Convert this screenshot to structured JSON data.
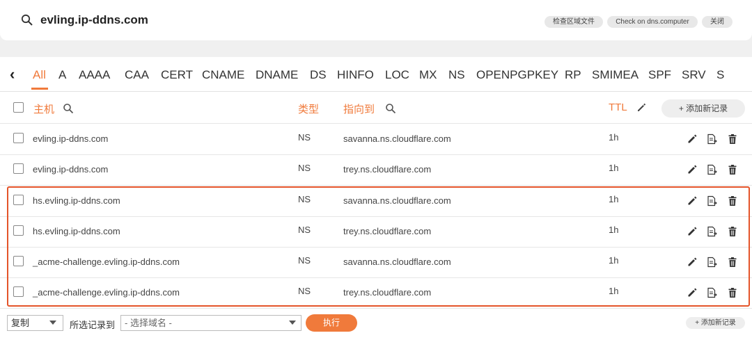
{
  "header": {
    "domain": "evling.ip-ddns.com",
    "buttons": [
      "检查区域文件",
      "Check on dns.computer",
      "关闭"
    ]
  },
  "tabs": [
    "All",
    "A",
    "AAAA",
    "CAA",
    "CERT",
    "CNAME",
    "DNAME",
    "DS",
    "HINFO",
    "LOC",
    "MX",
    "NS",
    "OPENPGPKEY",
    "RP",
    "SMIMEA",
    "SPF",
    "SRV",
    "S"
  ],
  "active_tab": "All",
  "columns": {
    "host": "主机",
    "type": "类型",
    "target": "指向到",
    "ttl": "TTL"
  },
  "add_record_label": "+ 添加新记录",
  "records": [
    {
      "host": "evling.ip-ddns.com",
      "type": "NS",
      "target": "savanna.ns.cloudflare.com",
      "ttl": "1h"
    },
    {
      "host": "evling.ip-ddns.com",
      "type": "NS",
      "target": "trey.ns.cloudflare.com",
      "ttl": "1h"
    },
    {
      "host": "hs.evling.ip-ddns.com",
      "type": "NS",
      "target": "savanna.ns.cloudflare.com",
      "ttl": "1h"
    },
    {
      "host": "hs.evling.ip-ddns.com",
      "type": "NS",
      "target": "trey.ns.cloudflare.com",
      "ttl": "1h"
    },
    {
      "host": "_acme-challenge.evling.ip-ddns.com",
      "type": "NS",
      "target": "savanna.ns.cloudflare.com",
      "ttl": "1h"
    },
    {
      "host": "_acme-challenge.evling.ip-ddns.com",
      "type": "NS",
      "target": "trey.ns.cloudflare.com",
      "ttl": "1h"
    }
  ],
  "footer": {
    "action_select": "复制",
    "label": "所选记录到",
    "domain_select": "- 选择域名 -",
    "execute": "执行",
    "add_record_label": "+ 添加新记录"
  },
  "colors": {
    "accent": "#f07a3b",
    "highlight_border": "#e4542a"
  }
}
